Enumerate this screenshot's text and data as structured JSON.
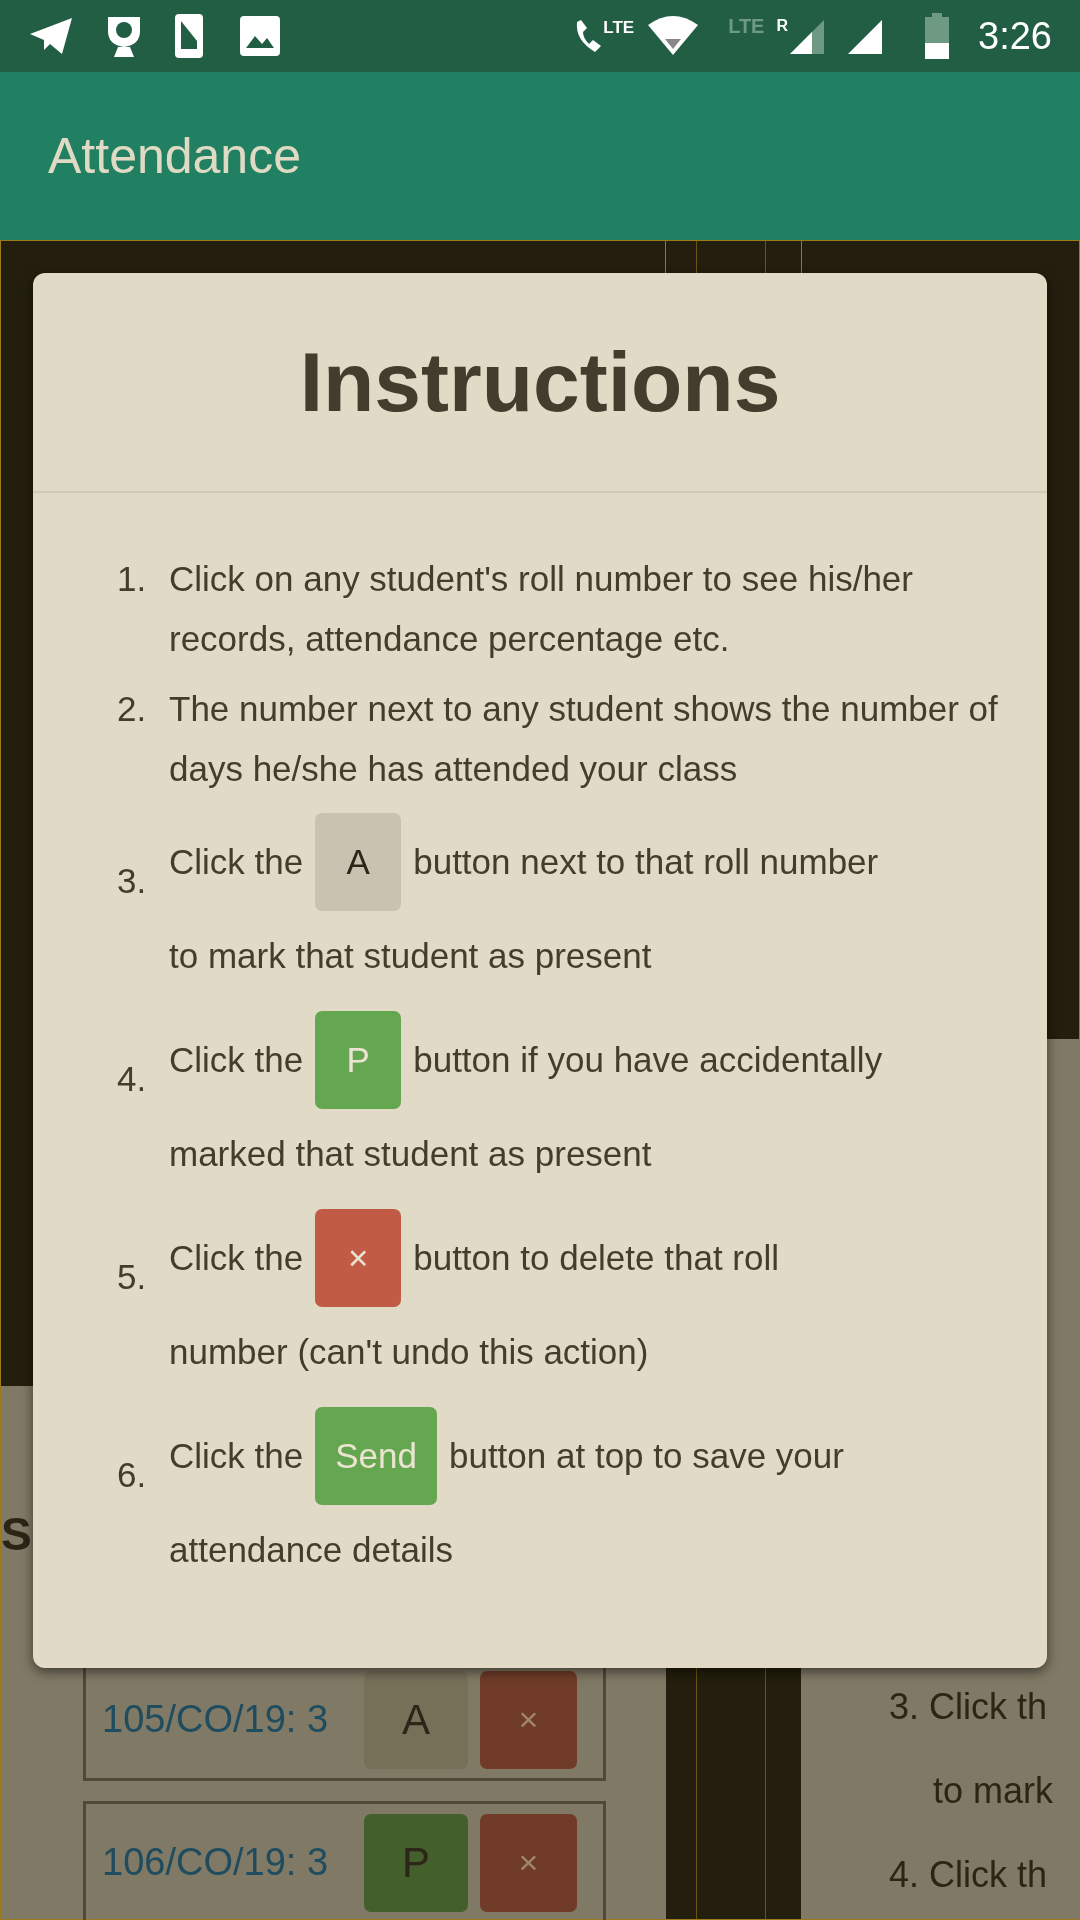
{
  "status_bar": {
    "call_label": "LTE",
    "network_label": "LTE",
    "roaming_label": "R",
    "time": "3:26"
  },
  "app_bar": {
    "title": "Attendance"
  },
  "background": {
    "heading_fragment": "S",
    "rows": [
      {
        "roll": "105/CO/19: 3",
        "mark": {
          "label": "A",
          "color": "#777059"
        },
        "delete": "×"
      },
      {
        "roll": "106/CO/19: 3",
        "mark": {
          "label": "P",
          "color": "#435f2b"
        },
        "delete": "×"
      }
    ],
    "right_fragments": [
      "3. Click th",
      "to mark",
      "4. Click th"
    ]
  },
  "dialog": {
    "title": "Instructions",
    "items": [
      {
        "number": "1.",
        "parts": [
          {
            "kind": "paragraph",
            "text": "Click on any student's roll number to see his/her records, attendance percentage etc."
          }
        ]
      },
      {
        "number": "2.",
        "parts": [
          {
            "kind": "paragraph",
            "text": "The number next to any student shows the number of days he/she has attended your class"
          }
        ]
      },
      {
        "number": "3.",
        "parts": [
          {
            "kind": "text",
            "text": "Click the"
          },
          {
            "kind": "button",
            "label": "A",
            "color": "#c9c2b0"
          },
          {
            "kind": "text",
            "text": "button next to that roll number"
          },
          {
            "kind": "line",
            "text": "to mark that student as present"
          }
        ]
      },
      {
        "number": "4.",
        "parts": [
          {
            "kind": "text",
            "text": "Click the"
          },
          {
            "kind": "button",
            "label": "P",
            "color": "#65a750"
          },
          {
            "kind": "text",
            "text": "button if you have accidentally"
          },
          {
            "kind": "line",
            "text": "marked that student as present"
          }
        ]
      },
      {
        "number": "5.",
        "parts": [
          {
            "kind": "text",
            "text": "Click the"
          },
          {
            "kind": "button",
            "label": "×",
            "color": "#c25b45"
          },
          {
            "kind": "text",
            "text": "button to delete that roll"
          },
          {
            "kind": "line",
            "text": "number (can't undo this action)"
          }
        ]
      },
      {
        "number": "6.",
        "parts": [
          {
            "kind": "text",
            "text": "Click the"
          },
          {
            "kind": "button",
            "label": "Send",
            "color": "#65a750"
          },
          {
            "kind": "text",
            "text": "button at top to save your"
          },
          {
            "kind": "line",
            "text": "attendance details"
          }
        ]
      }
    ]
  }
}
